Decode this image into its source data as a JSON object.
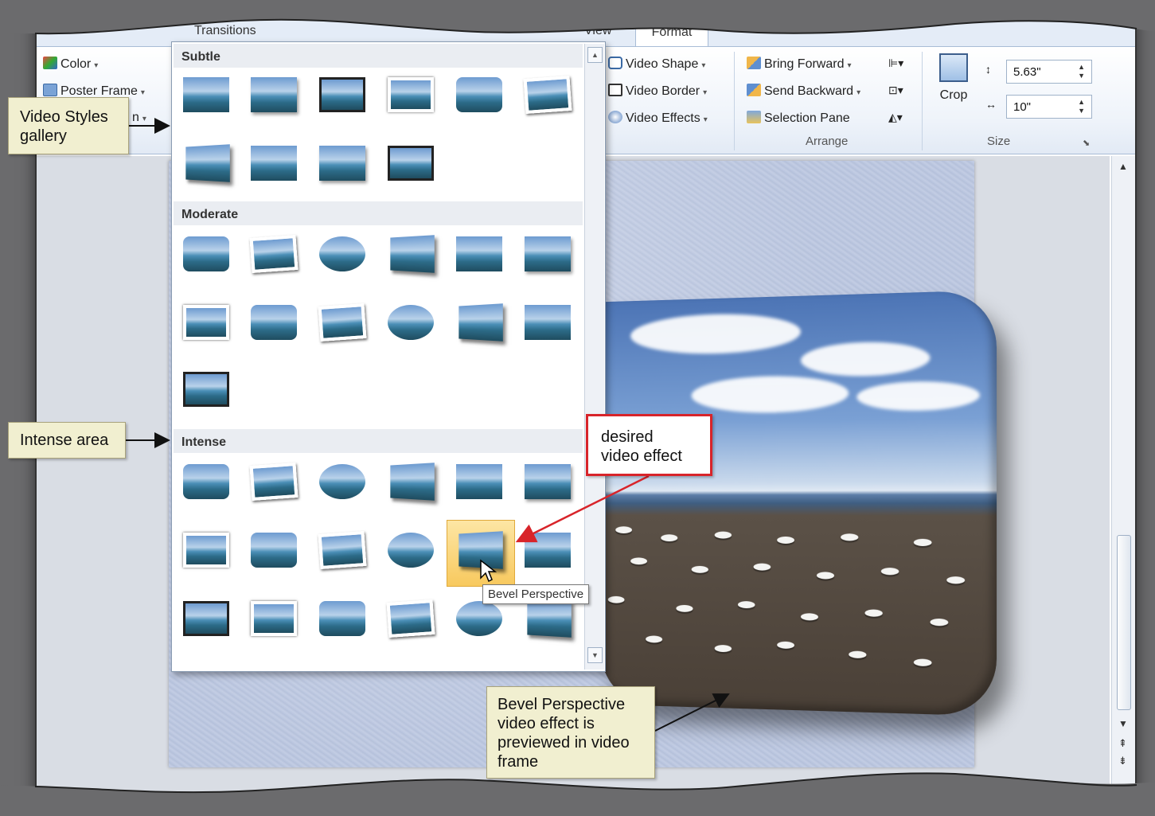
{
  "tabs": {
    "transitions": "Transitions",
    "view": "View",
    "format": "Format"
  },
  "ribbon": {
    "left_group": {
      "color": "Color",
      "poster_frame": "Poster Frame",
      "partial": "n"
    },
    "video_group": {
      "shape": "Video Shape",
      "border": "Video Border",
      "effects": "Video Effects"
    },
    "arrange": {
      "bring_forward": "Bring Forward",
      "send_backward": "Send Backward",
      "selection_pane": "Selection Pane",
      "label": "Arrange"
    },
    "size": {
      "crop": "Crop",
      "height": "5.63\"",
      "width": "10\"",
      "label": "Size"
    }
  },
  "gallery": {
    "sections": {
      "subtle": "Subtle",
      "moderate": "Moderate",
      "intense": "Intense"
    },
    "tooltip": "Bevel Perspective"
  },
  "callouts": {
    "video_styles_gallery": [
      "Video Styles",
      "gallery"
    ],
    "intense_area": "Intense area",
    "desired_effect": [
      "desired",
      "video effect"
    ],
    "previewed": [
      "Bevel Perspective",
      "video effect is",
      "previewed in video",
      "frame"
    ]
  },
  "colors": {
    "highlight": "#f8c95e",
    "callout_red": "#d8242a",
    "callout_bg": "#f1efd0"
  }
}
